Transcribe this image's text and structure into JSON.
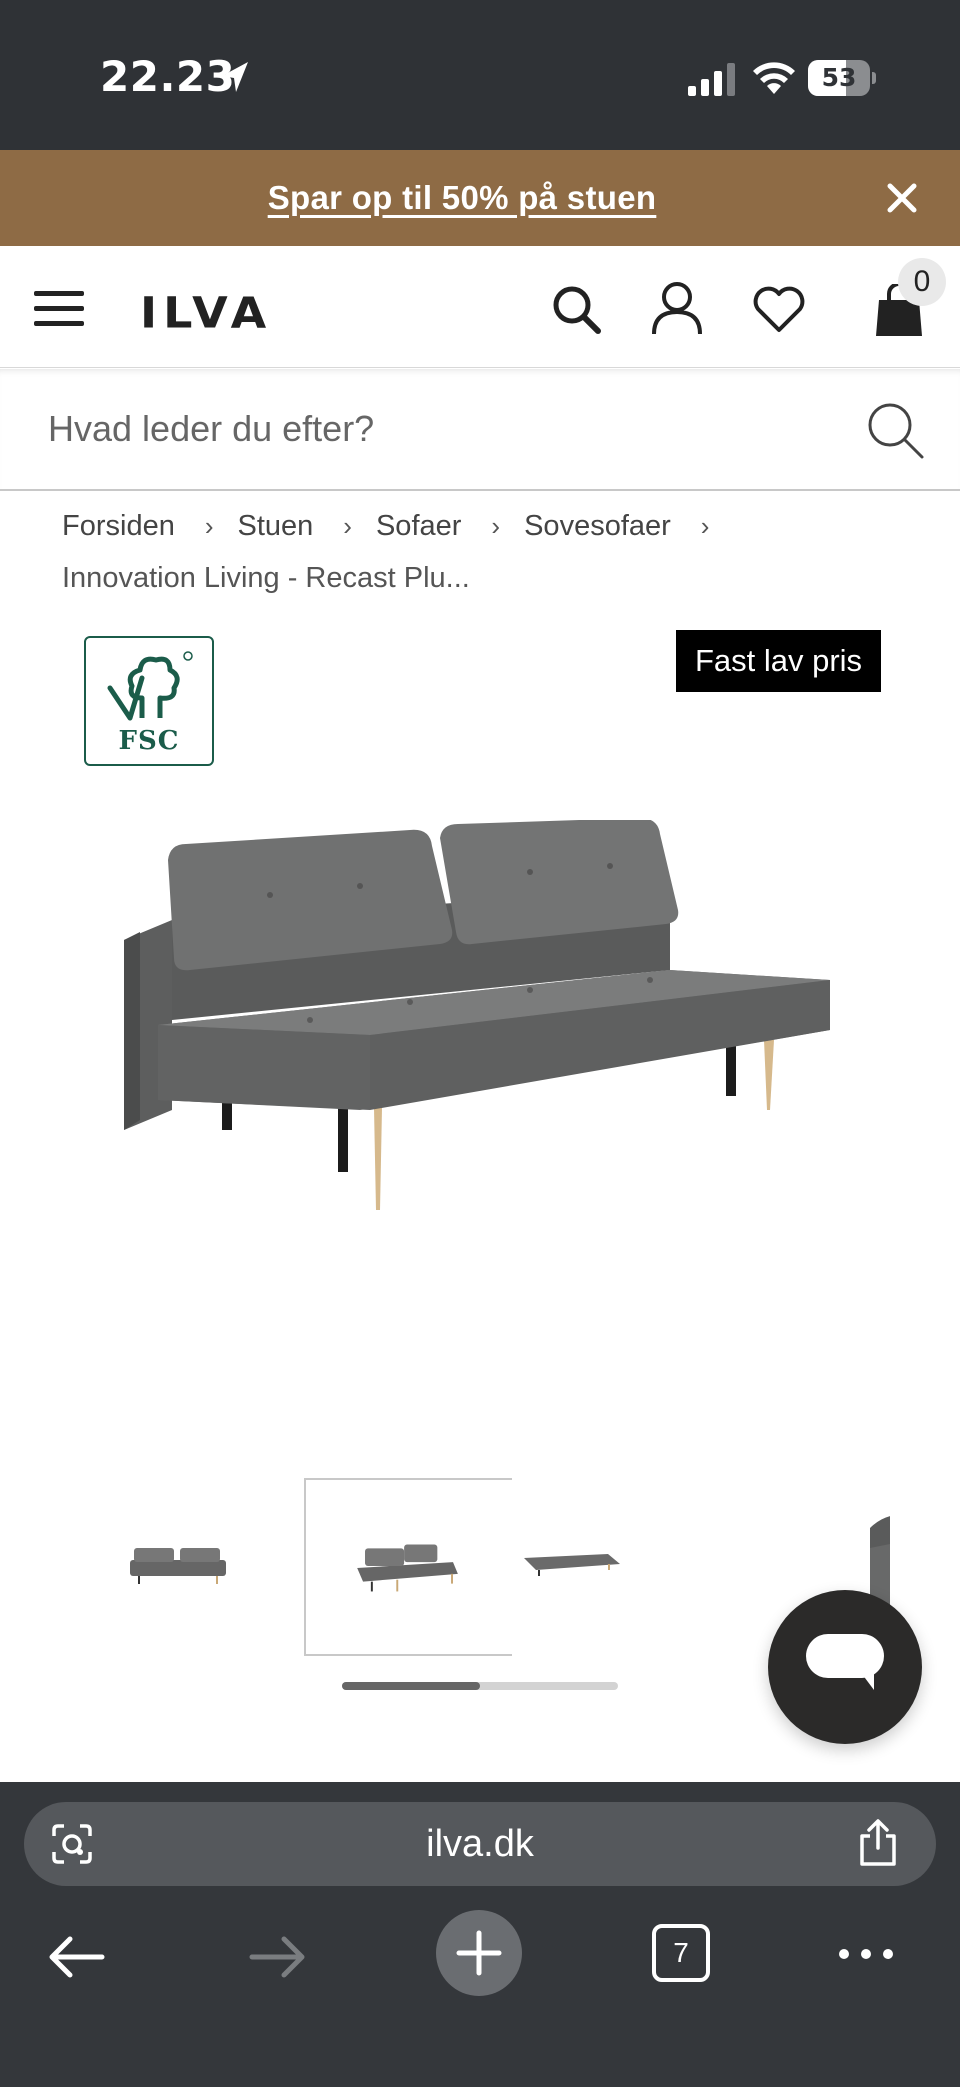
{
  "status_bar": {
    "time": "22.23",
    "battery_level": "53",
    "icons": [
      "location-arrow-icon",
      "signal-bars-icon",
      "wifi-icon",
      "battery-icon"
    ]
  },
  "promo": {
    "text": "Spar op til 50% på stuen",
    "close_icon": "close-icon",
    "background": "#8e6b45"
  },
  "header": {
    "logo": "ILVA",
    "cart_count": "0",
    "icons": [
      "menu-icon",
      "search-icon",
      "account-icon",
      "heart-icon",
      "bag-icon"
    ]
  },
  "search": {
    "placeholder": "Hvad leder du efter?",
    "value": ""
  },
  "breadcrumb": {
    "items": [
      "Forsiden",
      "Stuen",
      "Sofaer",
      "Sovesofaer"
    ],
    "separator": "›",
    "current": "Innovation Living - Recast Plu..."
  },
  "product": {
    "certification_label": "FSC",
    "price_badge": "Fast lav pris",
    "image_count_visible": 4,
    "active_thumbnail": 2,
    "gallery_progress": 0.5
  },
  "browser": {
    "url": "ilva.dk",
    "tab_count": "7",
    "icons": [
      "camera-search-icon",
      "share-icon",
      "back-arrow-icon",
      "forward-arrow-icon",
      "plus-icon",
      "tabs-icon",
      "more-icon"
    ]
  },
  "colors": {
    "status_bar": "#2f3236",
    "promo": "#8e6b45",
    "browser_chrome": "#34373b",
    "chat_button": "#2b2a29",
    "fsc_green": "#1b5c4a"
  }
}
